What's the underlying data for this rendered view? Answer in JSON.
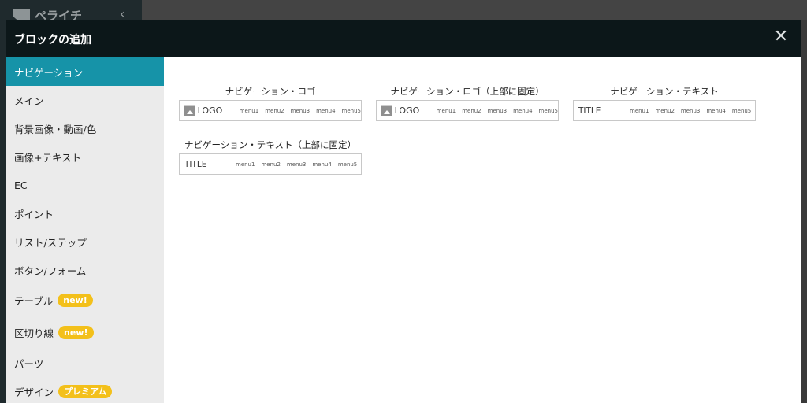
{
  "background_app": {
    "brand": "ペライチ",
    "collapse_icon": "chevron-left-icon"
  },
  "modal": {
    "title": "ブロックの追加",
    "close_icon": "close-icon"
  },
  "sidebar": {
    "items": [
      {
        "label": "ナビゲーション",
        "badge": ""
      },
      {
        "label": "メイン",
        "badge": ""
      },
      {
        "label": "背景画像・動画/色",
        "badge": ""
      },
      {
        "label": "画像+テキスト",
        "badge": ""
      },
      {
        "label": "EC",
        "badge": ""
      },
      {
        "label": "ポイント",
        "badge": ""
      },
      {
        "label": "リスト/ステップ",
        "badge": ""
      },
      {
        "label": "ボタン/フォーム",
        "badge": ""
      },
      {
        "label": "テーブル",
        "badge": "new!"
      },
      {
        "label": "区切り線",
        "badge": "new!"
      },
      {
        "label": "パーツ",
        "badge": ""
      },
      {
        "label": "デザイン",
        "badge": "プレミアム"
      }
    ],
    "active_index": 0
  },
  "blocks": [
    {
      "title": "ナビゲーション・ロゴ",
      "brand": "LOGO",
      "menus": [
        "menu1",
        "menu2",
        "menu3",
        "menu4",
        "menu5"
      ]
    },
    {
      "title": "ナビゲーション・ロゴ（上部に固定）",
      "brand": "LOGO",
      "menus": [
        "menu1",
        "menu2",
        "menu3",
        "menu4",
        "menu5"
      ]
    },
    {
      "title": "ナビゲーション・テキスト",
      "brand": "TITLE",
      "menus": [
        "menu1",
        "menu2",
        "menu3",
        "menu4",
        "menu5"
      ]
    },
    {
      "title": "ナビゲーション・テキスト（上部に固定）",
      "brand": "TITLE",
      "menus": [
        "menu1",
        "menu2",
        "menu3",
        "menu4",
        "menu5"
      ]
    }
  ],
  "colors": {
    "header_bg": "#0c1719",
    "accent": "#1693a8",
    "badge": "#f3c01a",
    "sidebar_bg": "#ebebeb"
  }
}
